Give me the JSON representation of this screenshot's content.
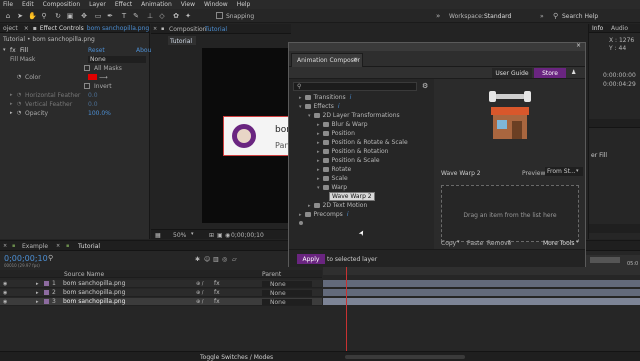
{
  "menu": [
    "File",
    "Edit",
    "Composition",
    "Layer",
    "Effect",
    "Animation",
    "View",
    "Window",
    "Help"
  ],
  "toolbar": {
    "snapping_label": "Snapping",
    "workspace_label": "Workspace:",
    "workspace_value": "Standard",
    "search_placeholder": "Search Help"
  },
  "left_panel": {
    "tab_project": "oject",
    "tab_effect_controls": "Effect Controls",
    "tab_effect_controls_target": "bom sanchopilla.png",
    "breadcrumb": "Tutorial • bom sanchopilla.png",
    "fx_name": "Fill",
    "reset_label": "Reset",
    "about_label": "About",
    "props": [
      {
        "label": "Fill Mask",
        "value": "None"
      },
      {
        "label": "",
        "value": "All Masks"
      },
      {
        "label": "Color",
        "value": ""
      },
      {
        "label": "",
        "value": "Invert"
      },
      {
        "label": "Horizontal Feather",
        "value": "0.0"
      },
      {
        "label": "Vertical Feather",
        "value": "0.0"
      },
      {
        "label": "Opacity",
        "value": "100.0%"
      }
    ]
  },
  "comp": {
    "panel_title": "Composition",
    "panel_tab": "Tutorial",
    "tab": "Tutorial",
    "card_title": "bom",
    "card_sub": "Pan",
    "zoom": "50%",
    "timecode": "0;00;00;10"
  },
  "right_panel": {
    "tab_info": "Info",
    "tab_audio": "Audio",
    "coord_x": "X : 1276",
    "coord_y": "Y : 44",
    "t1": "0:00:00:00",
    "t2": "0:00:04:29",
    "fill_label": "er Fill"
  },
  "dialog": {
    "title": "Animation Composer",
    "user_guide": "User Guide",
    "store": "Store",
    "tree": [
      {
        "label": "Transitions",
        "depth": 0,
        "type": "root",
        "info": true
      },
      {
        "label": "Effects",
        "depth": 0,
        "type": "root-open",
        "info": true
      },
      {
        "label": "2D Layer Transformations",
        "depth": 1,
        "type": "open"
      },
      {
        "label": "Blur & Warp",
        "depth": 2,
        "type": "closed"
      },
      {
        "label": "Position",
        "depth": 2,
        "type": "closed"
      },
      {
        "label": "Position & Rotate & Scale",
        "depth": 2,
        "type": "closed"
      },
      {
        "label": "Position & Rotation",
        "depth": 2,
        "type": "closed"
      },
      {
        "label": "Position & Scale",
        "depth": 2,
        "type": "closed"
      },
      {
        "label": "Rotate",
        "depth": 2,
        "type": "closed"
      },
      {
        "label": "Scale",
        "depth": 2,
        "type": "closed"
      },
      {
        "label": "Warp",
        "depth": 2,
        "type": "open"
      },
      {
        "label": "Wave Warp 2",
        "depth": 3,
        "type": "item"
      },
      {
        "label": "2D Text Motion",
        "depth": 1,
        "type": "closed"
      },
      {
        "label": "Precomps",
        "depth": 0,
        "type": "root",
        "info": true
      }
    ],
    "preset_name": "Wave Warp 2",
    "preview_label": "Preview",
    "preview_value": "From St...",
    "drop_hint": "Drag an item from the list here",
    "copy": "Copy",
    "paste": "Paste",
    "remove": "Remove",
    "more_tools": "More Tools",
    "apply": "Apply",
    "apply_target": "to selected layer"
  },
  "timeline": {
    "tab_example": "Example",
    "tab_tutorial": "Tutorial",
    "timecode": "0;00;00;10",
    "frames": "00010 (29.97 fps)",
    "col_source": "Source Name",
    "col_parent": "Parent",
    "layers": [
      {
        "num": "1",
        "name": "bom sanchopilla.png",
        "parent": "None"
      },
      {
        "num": "2",
        "name": "bom sanchopilla.png",
        "parent": "None"
      },
      {
        "num": "3",
        "name": "bom sanchopilla.png",
        "parent": "None"
      }
    ],
    "toggle_label": "Toggle Switches / Modes",
    "ruler_end": "05:0"
  },
  "colors": {
    "accent_purple": "#6a2580",
    "playhead_red": "#c83232",
    "timecode_blue": "#4c8fd4",
    "layer_bar": "#636a7b",
    "fill_red": "#e00000"
  }
}
